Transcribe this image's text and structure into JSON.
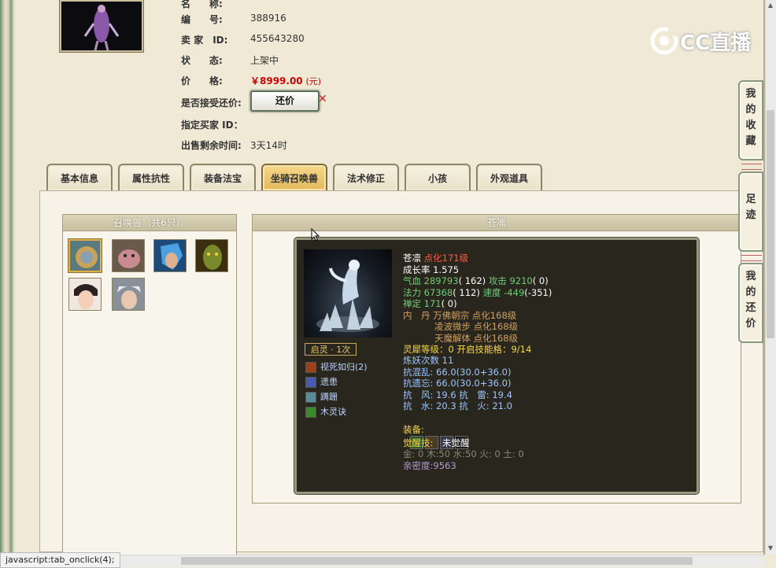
{
  "item": {
    "name_label": "名",
    "name_label2": "称:",
    "name_value": "",
    "serial_label": "编",
    "serial_label2": "号:",
    "serial_value": "388916",
    "seller_label": "卖",
    "seller_label2": "家",
    "seller_label3": "ID:",
    "seller_value": "455643280",
    "status_label": "状",
    "status_label2": "态:",
    "status_value": "上架中",
    "price_label": "价",
    "price_label2": "格:",
    "price_value": "￥8999.00",
    "price_unit": "(元)",
    "counter_q": "是否接受还价:",
    "counter_btn": "还价",
    "buyer_label": "指定买家 ID：",
    "remain_label": "出售剩余时间:",
    "remain_value": "3天14时"
  },
  "logo": {
    "text": "CC直播"
  },
  "tabs": [
    "基本信息",
    "属性抗性",
    "装备法宝",
    "坐骑召唤兽",
    "法术修正",
    "小孩",
    "外观道具"
  ],
  "active_tab": 3,
  "side_tabs": [
    "我的收藏",
    "足迹",
    "我的还价"
  ],
  "pet_list": {
    "title": "召唤兽（共6只）"
  },
  "detail": {
    "title": "苍凛",
    "badge": "启灵 · 1次",
    "skills": [
      "视死如归(2)",
      "遗患",
      "蹒跚",
      "木灵诀"
    ],
    "name": "苍凛",
    "name_tag": "点化171级",
    "growth": "成长率 1.575",
    "hp_label": "气血",
    "hp": "289793",
    "hp_extra": "( 162)",
    "atk_label": "攻击",
    "atk": "9210",
    "atk_extra": "( 0)",
    "mp_label": "法力",
    "mp": "67368",
    "mp_extra": "( 112)",
    "spd_label": "速度",
    "spd": "-449",
    "spd_extra": "(-351)",
    "def_label": "禅定",
    "def": "171",
    "def_extra": "( 0)",
    "neidan_label": "内　丹",
    "neidan": [
      "万佛朝宗 点化168级",
      "凌波微步 点化168级",
      "天魔解体 点化168级"
    ],
    "lingxi": "灵犀等级：",
    "lingxi_val": "0 开启技能格：9/14",
    "lianyao": "炼妖次数 11",
    "kang1": "抗混乱: 66.0(30.0+36.0)",
    "kang2": "抗遗忘: 66.0(30.0+36.0)",
    "kang3": "抗　风: 19.6 抗　雷: 19.4",
    "kang4": "抗　水: 20.3 抗　火: 21.0",
    "equip_label": "装备:",
    "awaken_label": "觉醒技:",
    "awaken_val": "未觉醒",
    "elements": "金: 0 木:50 水:50 火: 0 土: 0",
    "intimacy": "亲密度:9563"
  },
  "status_bar": "javascript:tab_onclick(4);",
  "colors": {
    "accent": "#e3b85c",
    "price": "#cc0000",
    "card_bg": "#29261d"
  }
}
